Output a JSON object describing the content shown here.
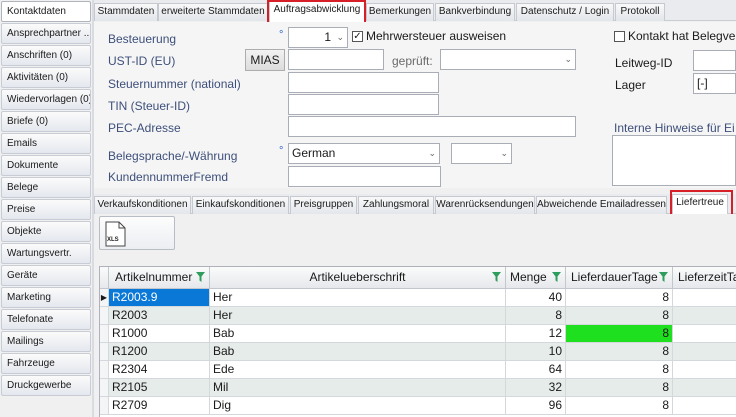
{
  "sidebar": {
    "items": [
      {
        "label": "Kontaktdaten"
      },
      {
        "label": "Ansprechpartner ..."
      },
      {
        "label": "Anschriften (0)"
      },
      {
        "label": "Aktivitäten (0)"
      },
      {
        "label": "Wiedervorlagen (0)"
      },
      {
        "label": "Briefe (0)"
      },
      {
        "label": "Emails"
      },
      {
        "label": "Dokumente"
      },
      {
        "label": "Belege"
      },
      {
        "label": "Preise"
      },
      {
        "label": "Objekte"
      },
      {
        "label": "Wartungsvertr."
      },
      {
        "label": "Geräte"
      },
      {
        "label": "Marketing"
      },
      {
        "label": "Telefonate"
      },
      {
        "label": "Mailings"
      },
      {
        "label": "Fahrzeuge"
      },
      {
        "label": "Druckgewerbe"
      }
    ]
  },
  "tabs": [
    {
      "label": "Stammdaten"
    },
    {
      "label": "erweiterte Stammdaten"
    },
    {
      "label": "Auftragsabwicklung"
    },
    {
      "label": "Bemerkungen"
    },
    {
      "label": "Bankverbindung"
    },
    {
      "label": "Datenschutz / Login"
    },
    {
      "label": "Protokoll"
    }
  ],
  "form": {
    "besteuerung_label": "Besteuerung",
    "besteuerung_value": "1",
    "mwst_label": "Mehrwersteuer ausweisen",
    "mwst_checked": "✓",
    "ustid_label": "UST-ID (EU)",
    "mias_button": "MIAS",
    "ustid_value": "",
    "geprueft_label": "geprüft:",
    "geprueft_value": "",
    "steuernummer_label": "Steuernummer (national)",
    "steuernummer_value": "",
    "tin_label": "TIN (Steuer-ID)",
    "tin_value": "",
    "pec_label": "PEC-Adresse",
    "pec_value": "",
    "belegsprache_label": "Belegsprache/-Währung",
    "belegsprache_value": "German",
    "waehrung_value": "",
    "kundennummer_label": "KundennummerFremd",
    "kundennummer_value": "",
    "kontakt_label": "Kontakt hat Belegver",
    "leitweg_label": "Leitweg-ID",
    "lager_label": "Lager",
    "lager_value": "[-]",
    "hinweise_label": "Interne Hinweise für Ei"
  },
  "subtabs": [
    {
      "label": "Verkaufskonditionen"
    },
    {
      "label": "Einkaufskonditionen"
    },
    {
      "label": "Preisgruppen"
    },
    {
      "label": "Zahlungsmoral"
    },
    {
      "label": "Warenrücksendungen"
    },
    {
      "label": "Abweichende Emailadressen"
    },
    {
      "label": "Liefertreue"
    }
  ],
  "toolbar": {
    "xls_label": "XLS"
  },
  "grid": {
    "columns": [
      "Artikelnummer",
      "Artikelueberschrift",
      "Menge",
      "LieferdauerTage",
      "LieferzeitTa"
    ],
    "rows": [
      {
        "artikelnummer": "R2003.9",
        "ueberschrift": "Her",
        "menge": "40",
        "lieferdauer": "8"
      },
      {
        "artikelnummer": "R2003",
        "ueberschrift": "Her",
        "menge": "8",
        "lieferdauer": "8"
      },
      {
        "artikelnummer": "R1000",
        "ueberschrift": "Bab",
        "menge": "12",
        "lieferdauer": "8"
      },
      {
        "artikelnummer": "R1200",
        "ueberschrift": "Bab",
        "menge": "10",
        "lieferdauer": "8"
      },
      {
        "artikelnummer": "R2304",
        "ueberschrift": "Ede",
        "menge": "64",
        "lieferdauer": "8"
      },
      {
        "artikelnummer": "R2105",
        "ueberschrift": "Mil",
        "menge": "32",
        "lieferdauer": "8"
      },
      {
        "artikelnummer": "R2709",
        "ueberschrift": "Dig",
        "menge": "96",
        "lieferdauer": "8"
      }
    ],
    "row_indicator": "▶",
    "selection_color": "#0a78d7",
    "highlight_color": "#1fe01f",
    "alt_row_color": "#e6ece9"
  },
  "colors": {
    "annotation_red": "#d61f26",
    "label_blue": "#3d4f7a"
  }
}
